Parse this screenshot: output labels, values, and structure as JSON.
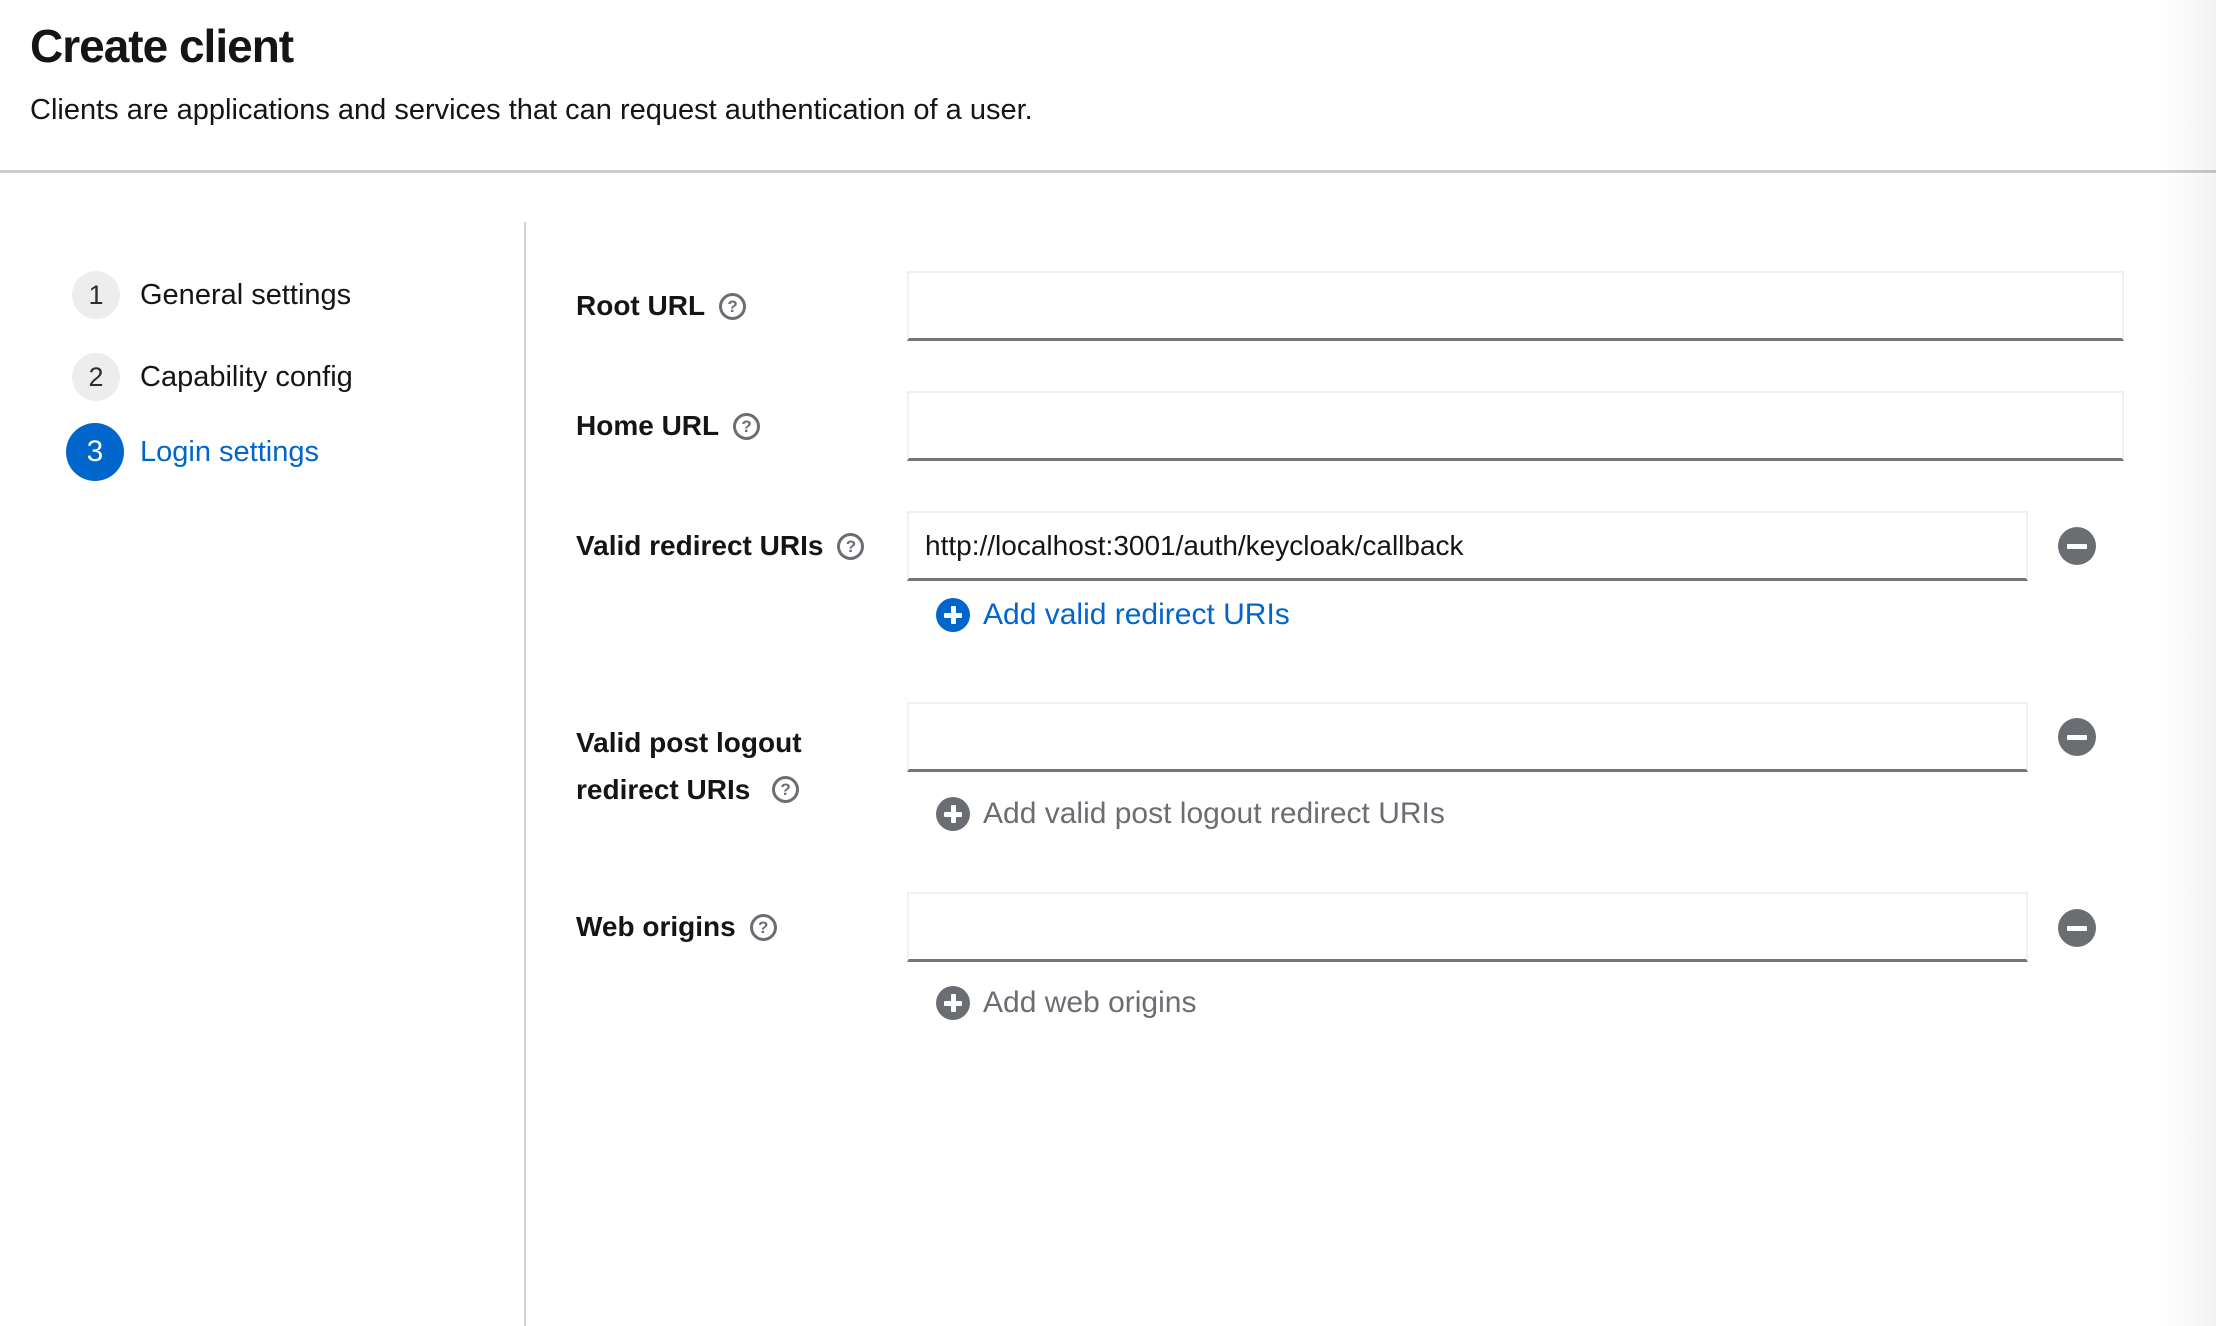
{
  "header": {
    "title": "Create client",
    "subtitle": "Clients are applications and services that can request authentication of a user."
  },
  "wizard": {
    "steps": [
      {
        "number": "1",
        "label": "General settings",
        "active": false
      },
      {
        "number": "2",
        "label": "Capability config",
        "active": false
      },
      {
        "number": "3",
        "label": "Login settings",
        "active": true
      }
    ]
  },
  "form": {
    "root_url": {
      "label": "Root URL",
      "value": ""
    },
    "home_url": {
      "label": "Home URL",
      "value": ""
    },
    "valid_redirect_uris": {
      "label": "Valid redirect URIs",
      "value": "http://localhost:3001/auth/keycloak/callback",
      "add_label": "Add valid redirect URIs",
      "add_enabled": true
    },
    "valid_post_logout_redirect_uris": {
      "label": "Valid post logout redirect URIs",
      "value": "",
      "add_label": "Add valid post logout redirect URIs",
      "add_enabled": false
    },
    "web_origins": {
      "label": "Web origins",
      "value": "",
      "add_label": "Add web origins",
      "add_enabled": false
    }
  },
  "icons": {
    "help": "question-circle-icon",
    "remove": "minus-circle-icon",
    "add": "plus-circle-icon"
  },
  "colors": {
    "accent_blue": "#0066cc",
    "text": "#151515",
    "muted_gray": "#6a6e73",
    "input_bottom_border": "#72767b",
    "divider": "#d2d2d2",
    "inactive_step_circle": "#ededed"
  }
}
